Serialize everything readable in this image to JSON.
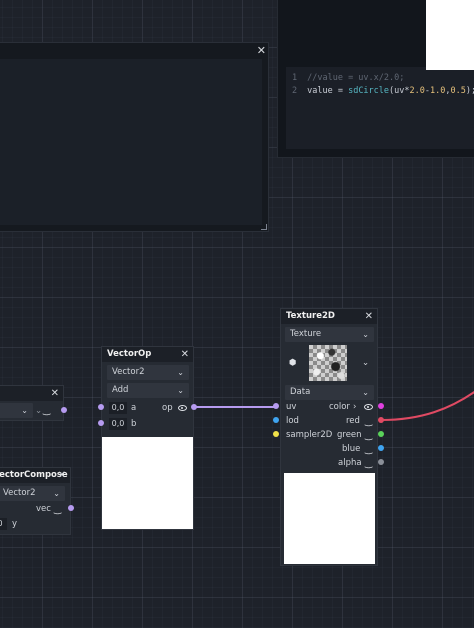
{
  "code_panel": {
    "lines": [
      {
        "num": "1",
        "text": "//value = uv.x/2.0;"
      },
      {
        "num": "2",
        "pre": "value = ",
        "fn": "sdCircle",
        "mid": "(uv*",
        "n1": "2.0",
        "op": "-",
        "n2": "1.0",
        "comma": ",",
        "n3": "0.5",
        "end": ");"
      }
    ]
  },
  "close_glyph": "✕",
  "vector_op": {
    "title": "VectorOp",
    "type_select": "Vector2",
    "op_select": "Add",
    "input_a_value": "0,0",
    "input_a_label": "a",
    "input_b_value": "0,0",
    "input_b_label": "b",
    "output_label": "op"
  },
  "texture2d": {
    "title": "Texture2D",
    "type_select": "Texture",
    "data_select": "Data",
    "inputs": [
      "uv",
      "lod",
      "sampler2D"
    ],
    "outputs": [
      "color",
      "red",
      "green",
      "blue",
      "alpha"
    ],
    "color_chevron": "›"
  },
  "vector_compose": {
    "title": "VectorCompose",
    "type_select": "Vector2",
    "output_label": "vec",
    "input_y_value": "0",
    "input_y_label": "y"
  },
  "partial_node": {
    "select_value": ""
  },
  "colors": {
    "wire_purple": "#b69bf0",
    "wire_red": "#e04a63",
    "socket_blue": "#3fa4f0",
    "socket_yellow": "#f0e14a",
    "socket_green": "#5ad25a",
    "socket_magenta": "#e040e0",
    "socket_grey": "#8a8f98"
  }
}
